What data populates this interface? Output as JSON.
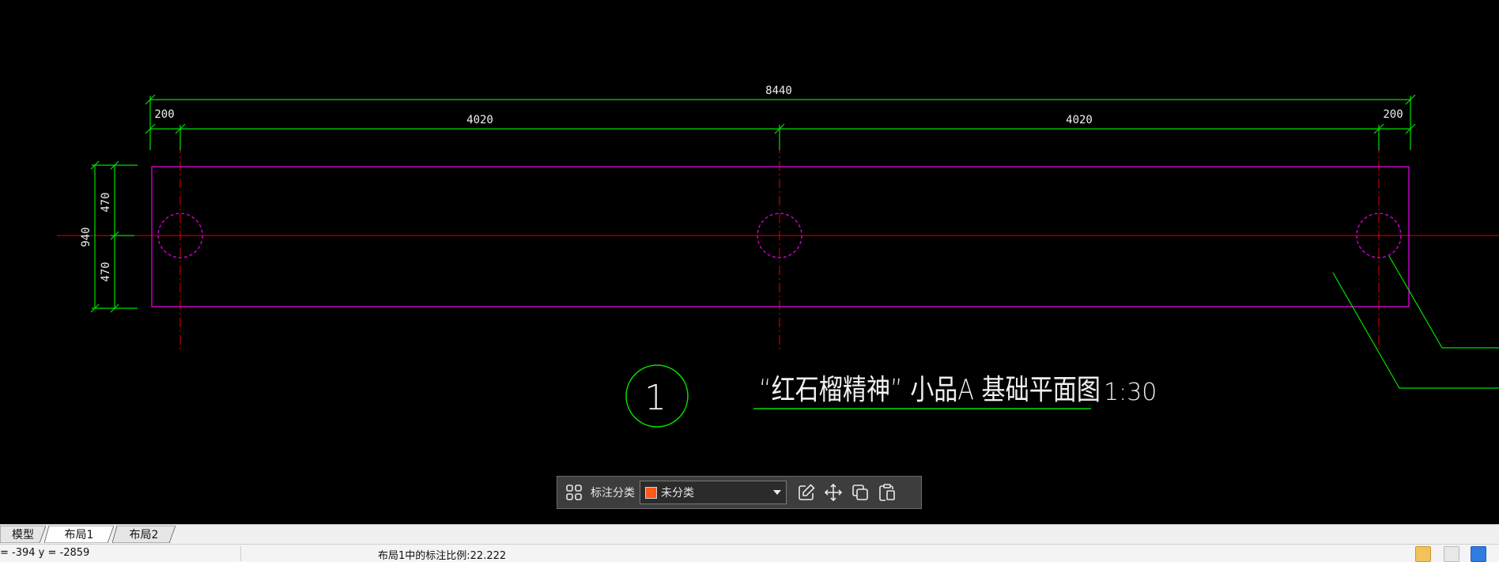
{
  "drawing": {
    "dimensions": {
      "overall": "8440",
      "left_end": "200",
      "left_span": "4020",
      "right_span": "4020",
      "right_end": "200",
      "total_height": "940",
      "upper_half": "470",
      "lower_half": "470"
    },
    "bubble_number": "1",
    "title": "“红石榴精神” 小品A 基础平面图",
    "scale": "1:30"
  },
  "colors": {
    "background": "#000000",
    "dimension": "#00e000",
    "outline": "#e000e0",
    "centerline": "#e00000",
    "title_text": "#f0f0f0"
  },
  "toolbar": {
    "grid_icon": "grid-icon",
    "label": "标注分类",
    "category_value": "未分类",
    "category_color": "#ff5a1a",
    "edit_icon": "edit-icon",
    "move_icon": "move-icon",
    "copy_icon": "copy-icon",
    "paste_icon": "paste-icon"
  },
  "tabs": [
    {
      "label": "模型"
    },
    {
      "label": "布局1"
    },
    {
      "label": "布局2"
    }
  ],
  "status": {
    "coords": "= -394 y = -2859",
    "scale_text": "布局1中的标注比例:22.222"
  }
}
